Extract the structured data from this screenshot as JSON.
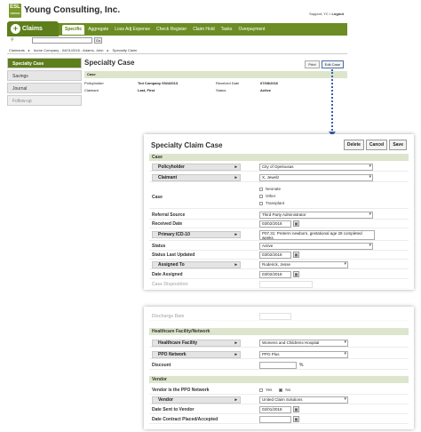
{
  "app": {
    "logo_text": "ESL",
    "logo_sub": "OFFICE",
    "company": "Young Consulting, Inc.",
    "support": "Support, YC",
    "logout": "Logout",
    "module": "Claims",
    "tabs": [
      "Specific",
      "Aggregate",
      "Loss Adj Expense",
      "Check Register",
      "Claim Hold",
      "Tasks",
      "Overpayment"
    ],
    "go_label": "Go",
    "breadcrumb": [
      "Claimants",
      "Acme Company - 04/01/2016 - Adams, John",
      "Specialty Claim"
    ]
  },
  "sidebar": {
    "items": [
      "Specialty Case",
      "Savings",
      "Journal",
      "Follow-up"
    ]
  },
  "bg_main": {
    "title": "Specialty Case",
    "print_label": "Print",
    "edit_label": "Edit Case",
    "section": "Case",
    "rows": [
      {
        "l1": "Policyholder",
        "v1": "Ted Company 05242013",
        "l2": "Received Date",
        "v2": "07/08/2016"
      },
      {
        "l1": "Claimant",
        "v1": "Last, First",
        "l2": "Status",
        "v2": "Active"
      }
    ]
  },
  "fg": {
    "title": "Specialty Claim Case",
    "buttons": [
      "Delete",
      "Cancel",
      "Save"
    ],
    "case_section": "Case",
    "policyholder_label": "Policyholder",
    "policyholder_value": "City of Opelousas",
    "claimant_label": "Claimant",
    "claimant_value": "X, Jewelz",
    "case_label": "Case",
    "case_options": [
      "Neonate",
      "Other",
      "Transplant"
    ],
    "referral_label": "Referral Source",
    "referral_value": "Third Party Administrator",
    "received_label": "Received Date",
    "received_value": "03/02/2018",
    "icd_label": "Primary ICD-10",
    "icd_value": "P07.31: Preterm newborn, gestational age 28 completed weeks",
    "status_label": "Status",
    "status_value": "Active",
    "status_updated_label": "Status Last Updated",
    "status_updated_value": "03/02/2018",
    "assigned_label": "Assigned To",
    "assigned_value": "Roderick, Jesse",
    "date_assigned_label": "Date Assigned",
    "date_assigned_value": "03/02/2018",
    "case_disposition_label": "Case Disposition",
    "discharge_label": "Discharge Date",
    "network_section": "Healthcare Facility/Network",
    "facility_label": "Healthcare Facility",
    "facility_value": "Womens and Childrens Hospital",
    "ppo_label": "PPO Network",
    "ppo_value": "PPO Plus",
    "discount_label": "Discount",
    "discount_unit": "%",
    "vendor_section": "Vendor",
    "vendor_is_ppo_label": "Vendor is the PPO Network",
    "yes_label": "Yes",
    "no_label": "No",
    "vendor_label": "Vendor",
    "vendor_value": "United Claim Solutions",
    "date_sent_label": "Date Sent to Vendor",
    "date_sent_value": "02/01/2018",
    "date_contract_label": "Date Contract Placed/Accepted"
  }
}
